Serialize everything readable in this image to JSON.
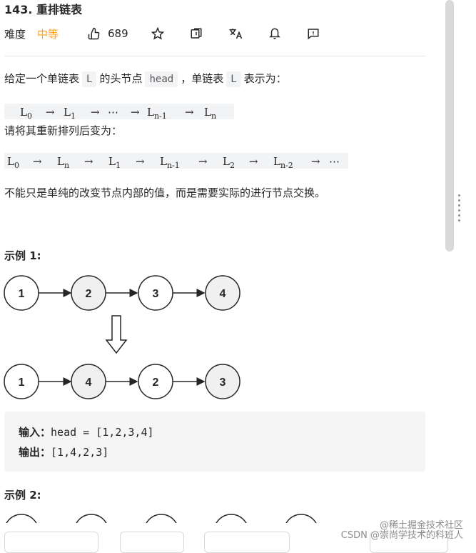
{
  "problem": {
    "title": "143. 重排链表",
    "difficulty_label": "难度",
    "difficulty_value": "中等",
    "likes": "689"
  },
  "description": {
    "p1_a": "给定一个单链表",
    "p1_code_l": "L",
    "p1_b": "的头节点",
    "p1_code_head": "head",
    "p1_c": "，单链表",
    "p1_code_l2": "L",
    "p1_d": "表示为：",
    "math1": {
      "items": [
        "L",
        "0",
        "→",
        "L",
        "1",
        "→",
        "⋯",
        "→",
        "L",
        "n-1",
        "→",
        "L",
        "n"
      ]
    },
    "p2": "请将其重新排列后变为：",
    "p3": "不能只是单纯的改变节点内部的值，而是需要实际的进行节点交换。"
  },
  "example1": {
    "title": "示例 1:",
    "before_nodes": [
      "1",
      "2",
      "3",
      "4"
    ],
    "after_nodes": [
      "1",
      "4",
      "2",
      "3"
    ],
    "input_label": "输入：",
    "input_value": "head = [1,2,3,4]",
    "output_label": "输出：",
    "output_value": "[1,4,2,3]"
  },
  "example2": {
    "title": "示例 2:"
  },
  "watermark": {
    "line1": "@稀土掘金技术社区",
    "line2": "CSDN @崇尚学技术的科班人"
  },
  "colors": {
    "accent_medium": "#ffa116",
    "node_fill_white": "#ffffff",
    "node_fill_grey": "#f0f0f0",
    "code_bg": "#f2f3f5"
  },
  "icons": [
    "thumbs-up-icon",
    "star-icon",
    "share-icon",
    "translate-icon",
    "bell-icon",
    "feedback-icon"
  ]
}
